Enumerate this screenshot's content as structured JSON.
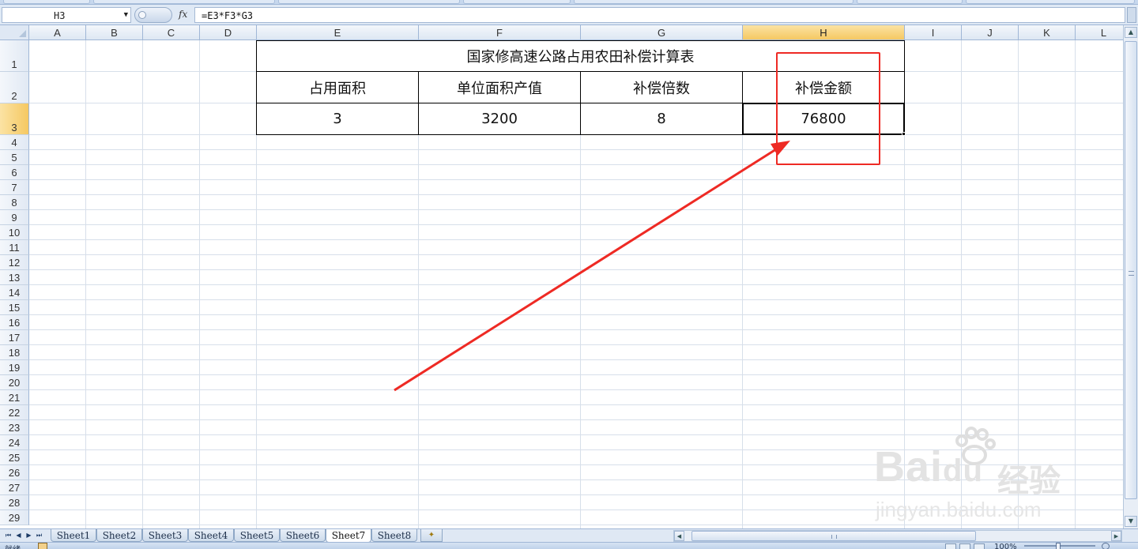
{
  "formula_bar": {
    "name_box": "H3",
    "fx_label": "fx",
    "formula": "=E3*F3*G3"
  },
  "columns": [
    "A",
    "B",
    "C",
    "D",
    "E",
    "F",
    "G",
    "H",
    "I",
    "J",
    "K",
    "L"
  ],
  "active_column": "H",
  "rows": [
    "1",
    "2",
    "3",
    "4",
    "5",
    "6",
    "7",
    "8",
    "9",
    "10",
    "11",
    "12",
    "13",
    "14",
    "15",
    "16",
    "17",
    "18",
    "19",
    "20",
    "21",
    "22",
    "23",
    "24",
    "25",
    "26",
    "27",
    "28",
    "29"
  ],
  "active_row": "3",
  "table": {
    "title": "国家修高速公路占用农田补偿计算表",
    "headers": [
      "占用面积",
      "单位面积产值",
      "补偿倍数",
      "补偿金额"
    ],
    "values": [
      "3",
      "3200",
      "8",
      "76800"
    ]
  },
  "sheet_tabs": [
    "Sheet1",
    "Sheet2",
    "Sheet3",
    "Sheet4",
    "Sheet5",
    "Sheet6",
    "Sheet7",
    "Sheet8"
  ],
  "active_sheet": "Sheet7",
  "status": {
    "ready": "就绪",
    "zoom": "100%"
  },
  "watermark": {
    "brand": "Bai",
    "brand_suffix": "du",
    "brand_cn": "经验",
    "url": "jingyan.baidu.com"
  },
  "annotation": {
    "color": "#ee2a24"
  }
}
